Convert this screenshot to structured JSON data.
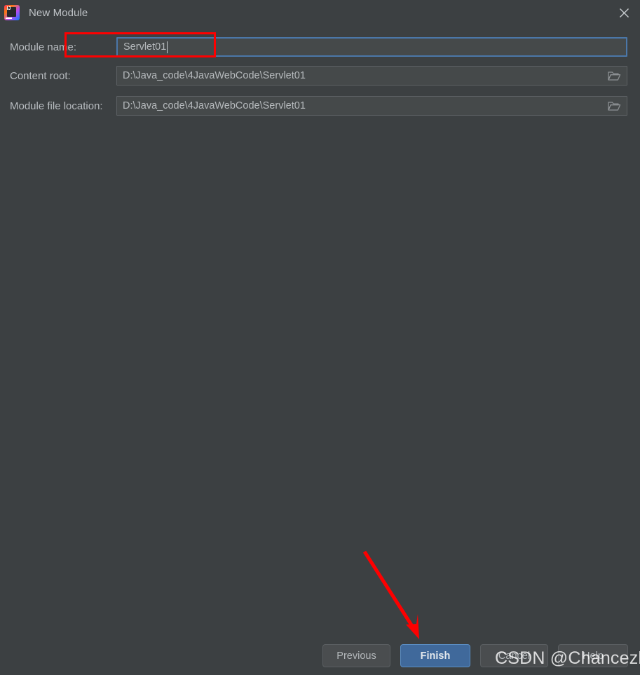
{
  "window": {
    "title": "New Module",
    "app_icon": "intellij-idea-icon",
    "close_icon": "close-icon"
  },
  "form": {
    "rows": [
      {
        "label": "Module name:",
        "value": "Servlet01",
        "focused": true,
        "has_browse": false
      },
      {
        "label": "Content root:",
        "value": "D:\\Java_code\\4JavaWebCode\\Servlet01",
        "focused": false,
        "has_browse": true,
        "browse_icon": "folder-icon"
      },
      {
        "label": "Module file location:",
        "value": "D:\\Java_code\\4JavaWebCode\\Servlet01",
        "focused": false,
        "has_browse": true,
        "browse_icon": "folder-icon"
      }
    ]
  },
  "buttons": {
    "previous": "Previous",
    "finish": "Finish",
    "cancel": "Cancel",
    "help": "Help"
  },
  "annotations": {
    "highlight_color": "#fe0000",
    "arrow_color": "#fe0000",
    "rect_target": "module-name-label-and-field",
    "arrow_target": "finish-button"
  },
  "watermark": {
    "text": "CSDN @Chancezhou"
  },
  "colors": {
    "background": "#3c4042",
    "field_background": "#45494a",
    "focus_border": "#4b77a8",
    "primary_button": "#40699b",
    "text": "#b8bcc0"
  }
}
